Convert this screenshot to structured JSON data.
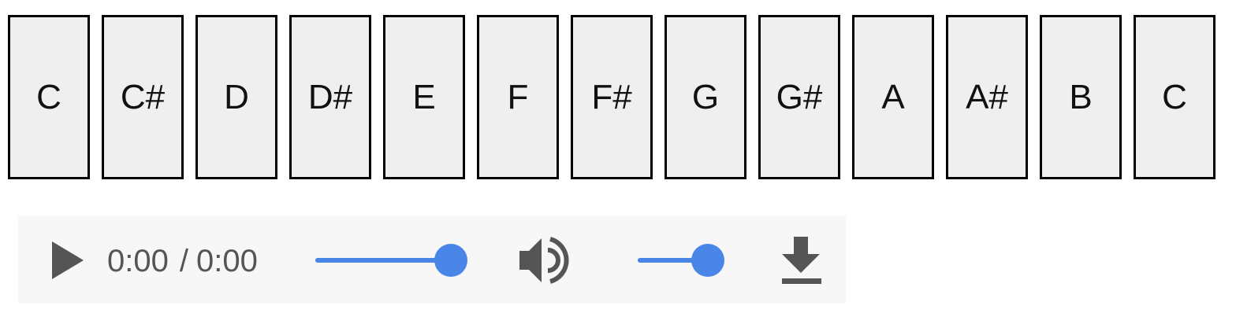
{
  "keys": [
    "C",
    "C#",
    "D",
    "D#",
    "E",
    "F",
    "F#",
    "G",
    "G#",
    "A",
    "A#",
    "B",
    "C"
  ],
  "player": {
    "current_time": "0:00",
    "separator": "/",
    "duration": "0:00",
    "progress": 1.0,
    "volume": 1.0,
    "play_icon": "play-icon",
    "volume_icon": "volume-icon",
    "download_icon": "download-icon"
  },
  "colors": {
    "key_background": "#efefef",
    "key_border": "#000000",
    "player_background": "#f7f7f7",
    "accent": "#4a86e8",
    "icon": "#555555"
  }
}
